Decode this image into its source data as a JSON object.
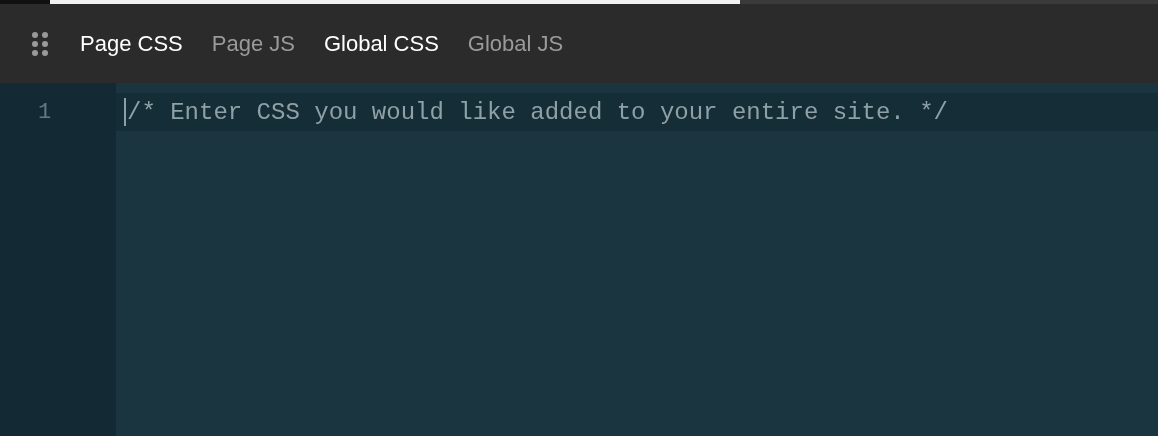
{
  "tabs": [
    {
      "label": "Page CSS",
      "selected": true
    },
    {
      "label": "Page JS",
      "selected": false
    },
    {
      "label": "Global CSS",
      "selected": true
    },
    {
      "label": "Global JS",
      "selected": false
    }
  ],
  "editor": {
    "lines": [
      {
        "number": "1",
        "text": "/* Enter CSS you would like added to your entire site. */",
        "current": true
      }
    ]
  }
}
